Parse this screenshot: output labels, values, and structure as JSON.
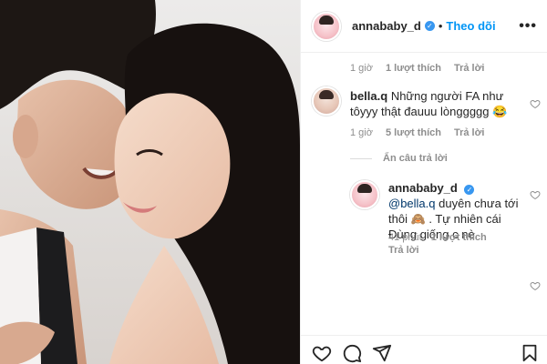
{
  "header": {
    "username": "annababy_d",
    "verified_glyph": "✓",
    "separator": "•",
    "follow_label": "Theo dõi",
    "more_label": "•••"
  },
  "comments": {
    "first_meta": {
      "time": "1 giờ",
      "likes": "1 lượt thích",
      "reply": "Trả lời"
    },
    "comment1": {
      "username": "bella.q",
      "text": "Những người FA như tôyyy thật đauuu lònggggg 😂",
      "time": "1 giờ",
      "likes": "5 lượt thích",
      "reply": "Trả lời"
    },
    "hide_replies_label": "Ẩn câu trả lời",
    "reply1": {
      "username": "annababy_d",
      "mention": "@bella.q",
      "text": "duyên chưa tới thôi 🙈 . Tự nhiên cái Đùng giống c nè",
      "time": "41 phút",
      "likes": "1 lượt thích",
      "reply": "Trả lời"
    }
  },
  "icons": {
    "more": "more-options-icon",
    "verified": "verified-badge-icon",
    "like": "heart-icon",
    "comment": "comment-bubble-icon",
    "share": "paper-plane-icon",
    "save": "bookmark-icon"
  },
  "colors": {
    "accent": "#0095f6",
    "verified": "#3897f0",
    "muted": "#8e8e8e",
    "text": "#262626",
    "mention": "#00376b"
  }
}
